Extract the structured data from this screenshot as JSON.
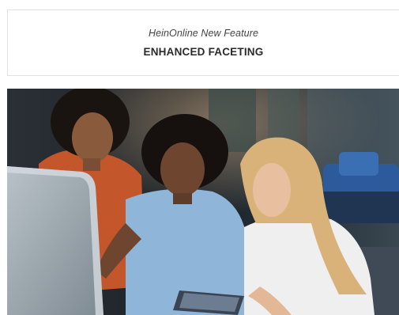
{
  "feature": {
    "kicker": "HeinOnline New Feature",
    "title": "ENHANCED FACETING"
  },
  "hero": {
    "icon": "photo-people-at-laptop",
    "colors": {
      "background_dark": "#1d2328",
      "accent_blue": "#2d5a9a",
      "shirt_orange": "#c4562c",
      "shirt_light_blue": "#8fb6d9",
      "shirt_white": "#efefef"
    }
  }
}
